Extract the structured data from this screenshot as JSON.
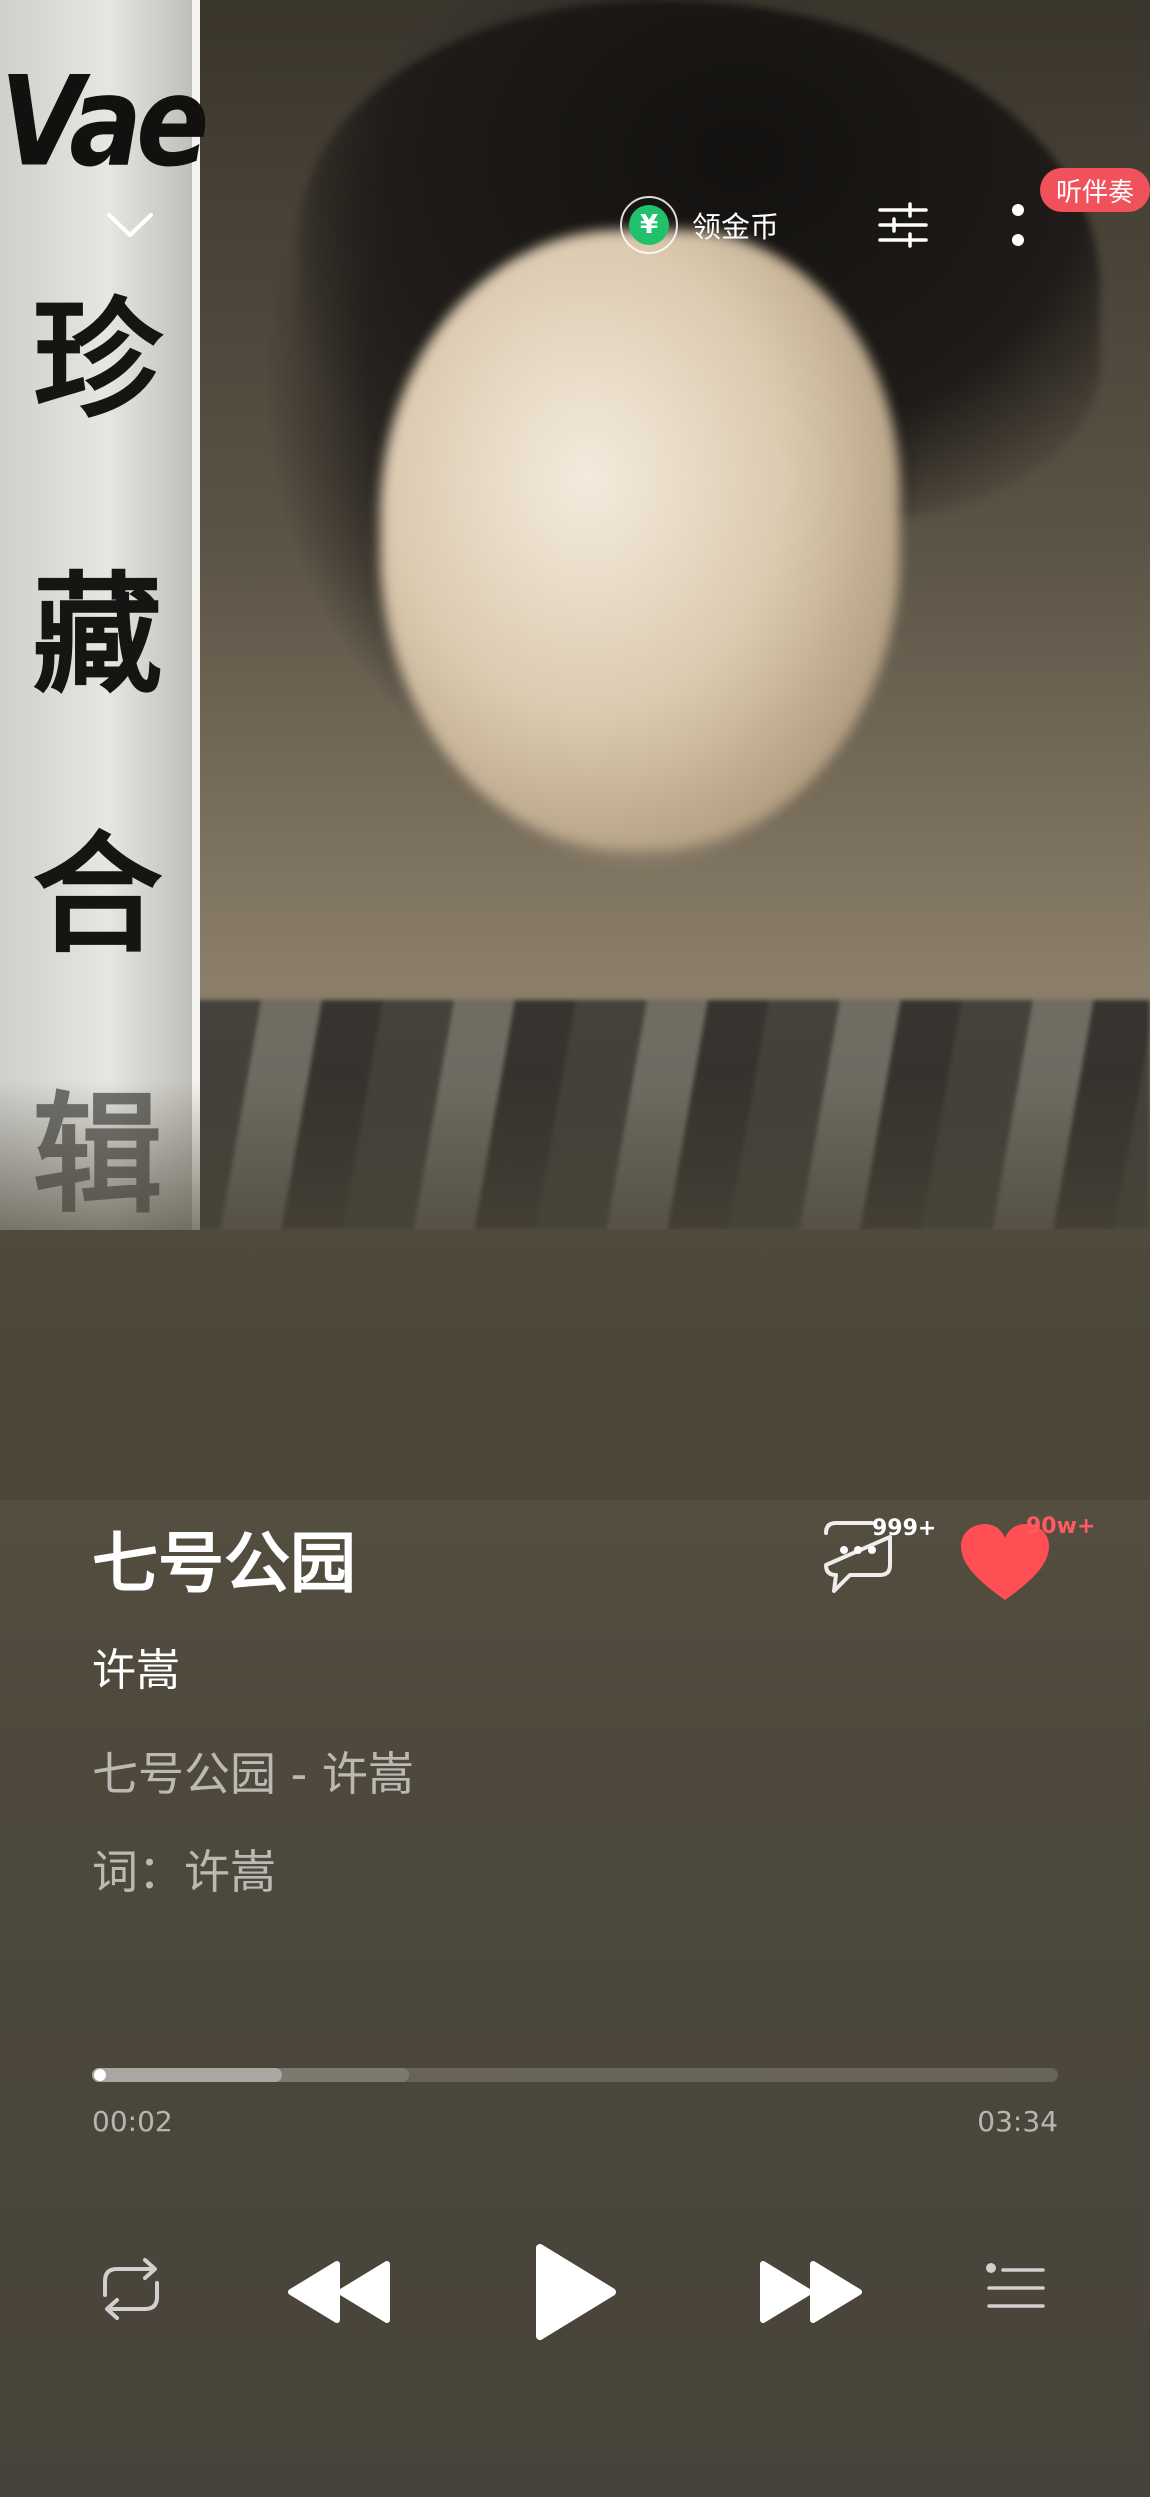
{
  "cover": {
    "brand_text": "Vae",
    "title_chars": [
      "珍",
      "藏",
      "合",
      "辑"
    ]
  },
  "topbar": {
    "collapse_icon": "chevron-down-icon",
    "coin_icon": "yuan-coin-icon",
    "coin_label": "领金币",
    "equalizer_icon": "sliders-icon",
    "more_icon": "more-vertical-icon",
    "accompaniment_badge": "听伴奏",
    "badge_color": "#f0515a"
  },
  "song": {
    "title": "七号公园",
    "artist": "许嵩",
    "lyric_lines": [
      "七号公园 - 许嵩",
      "词：许嵩"
    ]
  },
  "actions": {
    "comment_icon": "comment-bubble-icon",
    "comment_count": "999+",
    "like_icon": "heart-icon",
    "like_count": "90w+",
    "like_color": "#ff4f55"
  },
  "progress": {
    "current": "00:02",
    "total": "03:34",
    "played_fraction": 0.01
  },
  "controls": {
    "repeat_icon": "repeat-icon",
    "prev_icon": "previous-icon",
    "play_icon": "play-icon",
    "next_icon": "next-icon",
    "playlist_icon": "playlist-icon"
  }
}
